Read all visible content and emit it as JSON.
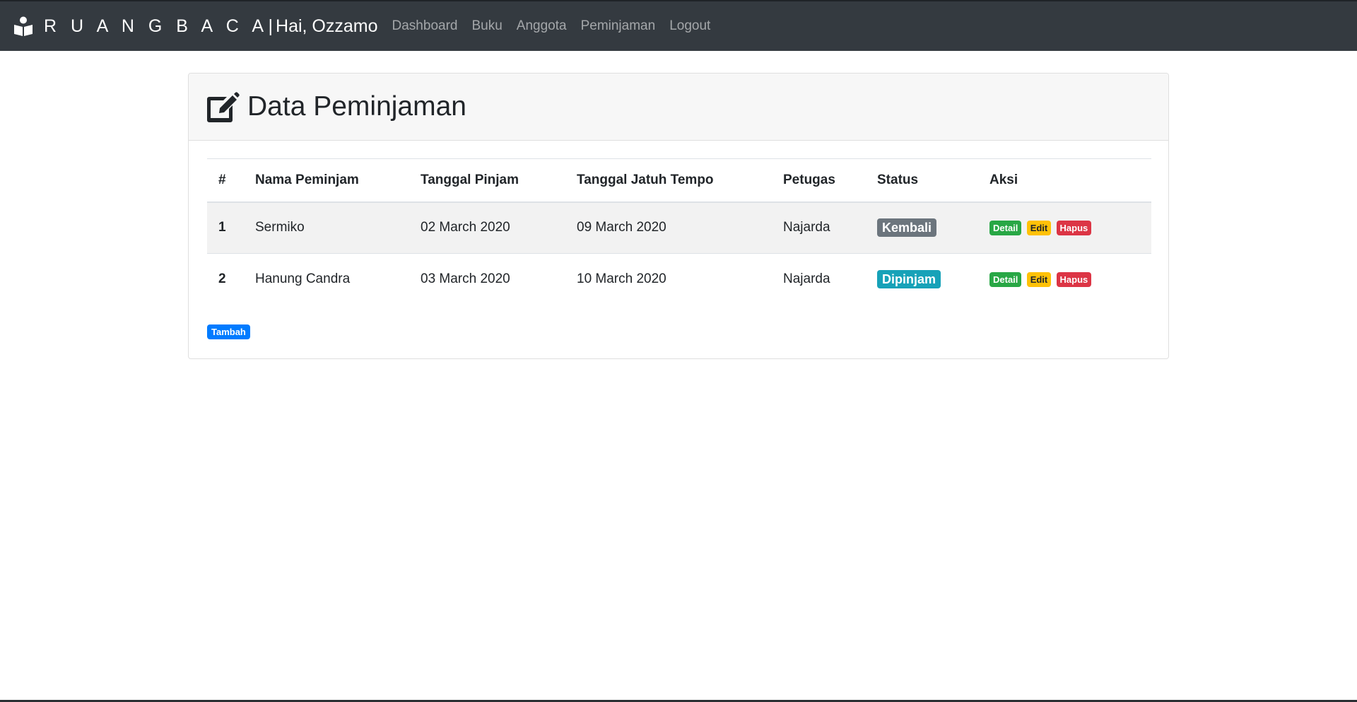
{
  "navbar": {
    "brand_name": "R U A N G B A C A",
    "brand_separator": "|",
    "greeting": "Hai, Ozzamo",
    "logo_icon": "book-reader-icon",
    "links": [
      "Dashboard",
      "Buku",
      "Anggota",
      "Peminjaman",
      "Logout"
    ]
  },
  "card": {
    "title": "Data Peminjaman",
    "title_icon": "edit-icon"
  },
  "table": {
    "headers": [
      "#",
      "Nama Peminjam",
      "Tanggal Pinjam",
      "Tanggal Jatuh Tempo",
      "Petugas",
      "Status",
      "Aksi"
    ],
    "rows": [
      {
        "no": "1",
        "nama": "Sermiko",
        "tgl_pinjam": "02 March 2020",
        "tgl_tempo": "09 March 2020",
        "petugas": "Najarda",
        "status": "Kembali",
        "status_color": "#6c757d"
      },
      {
        "no": "2",
        "nama": "Hanung Candra",
        "tgl_pinjam": "03 March 2020",
        "tgl_tempo": "10 March 2020",
        "petugas": "Najarda",
        "status": "Dipinjam",
        "status_color": "#17a2b8"
      }
    ],
    "actions": {
      "detail": "Detail",
      "edit": "Edit",
      "hapus": "Hapus"
    }
  },
  "add_button": "Tambah",
  "colors": {
    "navbar_bg": "#343a40",
    "success": "#28a745",
    "warning": "#ffc107",
    "danger": "#dc3545",
    "primary": "#007bff"
  }
}
